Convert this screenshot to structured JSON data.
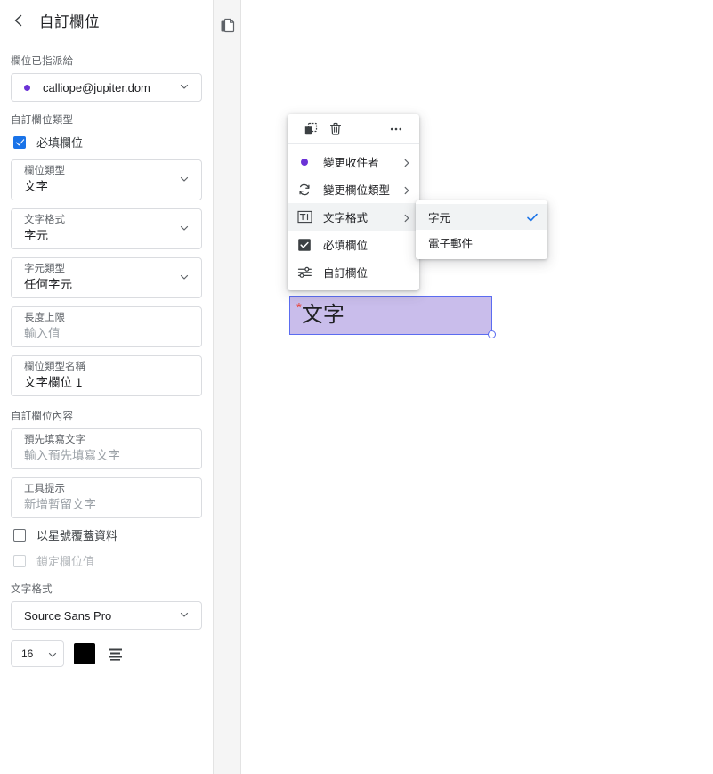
{
  "sidebar": {
    "back_icon": "chevron-left-icon",
    "title": "自訂欄位",
    "assignee_section_label": "欄位已指派給",
    "assignee": {
      "value": "calliope@jupiter.dom",
      "dot_color": "#6b32d6",
      "caret_icon": "chevron-down-icon"
    },
    "field_type_section_label": "自訂欄位類型",
    "required_checkbox": {
      "label": "必填欄位",
      "checked": true,
      "accent": "#1a73e8"
    },
    "fields": [
      {
        "label": "欄位類型",
        "value": "文字",
        "is_placeholder": false,
        "caret": true
      },
      {
        "label": "文字格式",
        "value": "字元",
        "is_placeholder": false,
        "caret": true
      },
      {
        "label": "字元類型",
        "value": "任何字元",
        "is_placeholder": false,
        "caret": true
      },
      {
        "label": "長度上限",
        "value": "輸入值",
        "is_placeholder": true,
        "caret": false
      },
      {
        "label": "欄位類型名稱",
        "value": "文字欄位 1",
        "is_placeholder": false,
        "caret": false
      }
    ],
    "content_section_label": "自訂欄位內容",
    "content_fields": [
      {
        "label": "預先填寫文字",
        "value": "輸入預先填寫文字",
        "is_placeholder": true,
        "caret": false
      },
      {
        "label": "工具提示",
        "value": "新增暫留文字",
        "is_placeholder": true,
        "caret": false
      }
    ],
    "mask_checkbox": {
      "label": "以星號覆蓋資料",
      "checked": false,
      "disabled": false
    },
    "lock_checkbox": {
      "label": "鎖定欄位值",
      "checked": false,
      "disabled": true
    },
    "text_format_section_label": "文字格式",
    "font_family": {
      "value": "Source Sans Pro",
      "caret_icon": "chevron-down-icon"
    },
    "font_size": {
      "value": "16",
      "caret_icon": "chevron-down-icon"
    },
    "font_color": {
      "value": "#000000"
    },
    "align_button": {
      "icon": "text-align-icon"
    }
  },
  "gutter": {
    "pages_icon": "pages-icon"
  },
  "canvas": {
    "field_widget": {
      "required_marker": "*",
      "text": "文字",
      "background": "#c9bdeb",
      "border_color": "#5b6cf0",
      "marker_color": "#e8453c"
    }
  },
  "context_menu": {
    "tools": [
      {
        "name": "duplicate-icon",
        "title": "duplicate"
      },
      {
        "name": "delete-icon",
        "title": "delete"
      },
      {
        "name": "more-options-icon",
        "title": "more"
      }
    ],
    "items": [
      {
        "icon": "recipient-dot-icon",
        "label": "變更收件者",
        "has_submenu": true,
        "active": false
      },
      {
        "icon": "change-field-type-icon",
        "label": "變更欄位類型",
        "has_submenu": true,
        "active": false
      },
      {
        "icon": "text-format-icon",
        "label": "文字格式",
        "has_submenu": true,
        "active": true
      },
      {
        "icon": "checkbox-checked-icon",
        "label": "必填欄位",
        "has_submenu": false,
        "active": false
      },
      {
        "icon": "sliders-icon",
        "label": "自訂欄位",
        "has_submenu": false,
        "active": false
      }
    ],
    "submenu": {
      "items": [
        {
          "label": "字元",
          "selected": true,
          "checked": true
        },
        {
          "label": "電子郵件",
          "selected": false,
          "checked": false
        }
      ],
      "check_color": "#1a73e8"
    }
  }
}
